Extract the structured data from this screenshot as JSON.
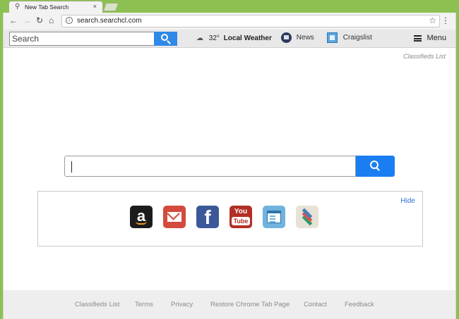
{
  "browser": {
    "tab_title": "New Tab Search",
    "tab_close": "×",
    "url": "search.searchcl.com",
    "icons": [
      "back-arrow-icon",
      "forward-arrow-icon",
      "reload-icon",
      "home-icon",
      "info-icon",
      "star-icon",
      "kebab-menu-icon"
    ]
  },
  "header": {
    "search_placeholder": "Search",
    "weather_temp": "32°",
    "weather_label": "Local Weather",
    "news_label": "News",
    "craigslist_label": "Craigslist",
    "menu_label": "Menu"
  },
  "main": {
    "classifieds_link": "Classifieds List",
    "hide_label": "Hide",
    "shortcuts": [
      {
        "name": "amazon",
        "glyph": "a"
      },
      {
        "name": "gmail",
        "glyph": ""
      },
      {
        "name": "facebook",
        "glyph": "f"
      },
      {
        "name": "youtube",
        "glyph_top": "You",
        "glyph_bottom": "Tube"
      },
      {
        "name": "browser",
        "glyph": ""
      },
      {
        "name": "layers",
        "glyph": ""
      }
    ]
  },
  "footer": {
    "links": [
      "Classifieds List",
      "Terms",
      "Privacy",
      "Restore Chrome Tab Page",
      "Contact",
      "Feedback"
    ]
  },
  "colors": {
    "window_frame": "#8cc152",
    "accent_blue": "#1a7ef2",
    "header_bar": "#e8e8e8"
  }
}
